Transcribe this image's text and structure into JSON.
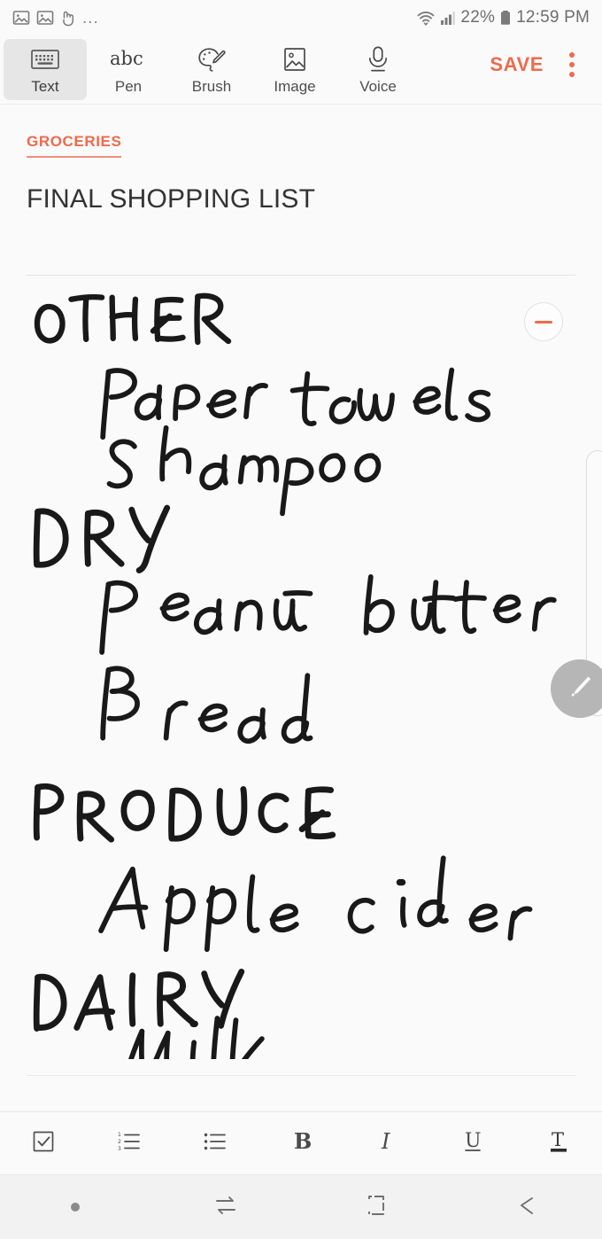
{
  "status_bar": {
    "left_icons": [
      "image-icon",
      "image-icon",
      "touch-icon"
    ],
    "more_indicator": "...",
    "wifi_icon": "wifi-icon",
    "signal_icon": "signal-bars-icon",
    "battery_percent": "22%",
    "battery_icon": "battery-icon",
    "time": "12:59 PM"
  },
  "toolbar": {
    "tools": [
      {
        "label": "Text",
        "icon": "keyboard-icon",
        "selected": true
      },
      {
        "label": "Pen",
        "icon": "abc-pen-icon",
        "selected": false
      },
      {
        "label": "Brush",
        "icon": "palette-brush-icon",
        "selected": false
      },
      {
        "label": "Image",
        "icon": "picture-icon",
        "selected": false
      },
      {
        "label": "Voice",
        "icon": "microphone-icon",
        "selected": false
      }
    ],
    "save_label": "SAVE",
    "overflow_label": "more-options",
    "accent_color": "#ef6a4c"
  },
  "note": {
    "category": "GROCERIES",
    "title": "FINAL SHOPPING LIST",
    "collapse_label": "collapse-section",
    "handwriting": {
      "blocks": [
        {
          "type": "heading",
          "text": "OTHER"
        },
        {
          "type": "item",
          "text": "Paper towels"
        },
        {
          "type": "item",
          "text": "Shampoo"
        },
        {
          "type": "heading",
          "text": "DRY"
        },
        {
          "type": "item",
          "text": "Peanut butter"
        },
        {
          "type": "item",
          "text": "Bread"
        },
        {
          "type": "heading",
          "text": "PRODUCE"
        },
        {
          "type": "item",
          "text": "Apple cider"
        },
        {
          "type": "heading",
          "text": "DAIRY"
        },
        {
          "type": "item",
          "text": "Milk"
        }
      ]
    }
  },
  "format_bar": {
    "items": [
      {
        "icon": "checkbox-icon",
        "label": "Checklist"
      },
      {
        "icon": "numbered-list-icon",
        "label": "Numbered list"
      },
      {
        "icon": "bullet-list-icon",
        "label": "Bulleted list"
      },
      {
        "icon": "bold-icon",
        "label": "B"
      },
      {
        "icon": "italic-icon",
        "label": "I"
      },
      {
        "icon": "underline-icon",
        "label": "U"
      },
      {
        "icon": "text-color-icon",
        "label": "T"
      }
    ]
  },
  "nav_bar": {
    "items": [
      {
        "icon": "dot-icon",
        "label": "Notification dot"
      },
      {
        "icon": "recents-icon",
        "label": "Recents"
      },
      {
        "icon": "home-icon",
        "label": "Home"
      },
      {
        "icon": "back-icon",
        "label": "Back"
      }
    ]
  }
}
